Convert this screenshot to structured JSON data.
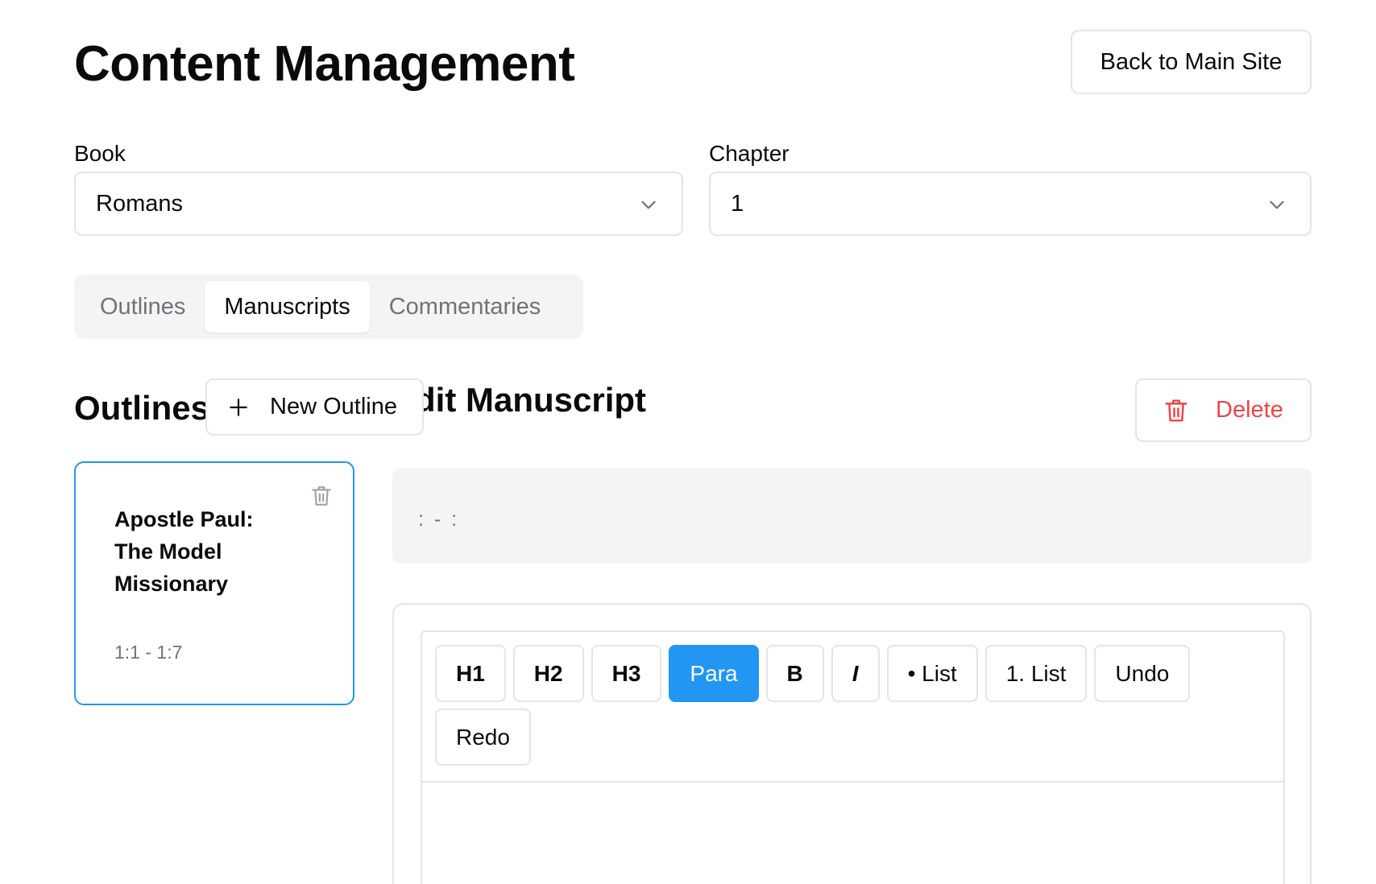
{
  "header": {
    "title": "Content Management",
    "back_label": "Back to Main Site"
  },
  "filters": {
    "book_label": "Book",
    "book_value": "Romans",
    "chapter_label": "Chapter",
    "chapter_value": "1"
  },
  "tabs": [
    {
      "label": "Outlines",
      "active": false
    },
    {
      "label": "Manuscripts",
      "active": true
    },
    {
      "label": "Commentaries",
      "active": false
    }
  ],
  "outlines": {
    "heading": "Outlines",
    "new_label": "New Outline",
    "items": [
      {
        "title": "Apostle Paul: The Model Missionary",
        "range": "1:1 - 1:7"
      }
    ]
  },
  "manuscript": {
    "heading": "Edit Manuscript",
    "delete_label": "Delete",
    "reference": ": - :"
  },
  "editor": {
    "toolbar": [
      "H1",
      "H2",
      "H3",
      "Para",
      "B",
      "I",
      "• List",
      "1. List",
      "Undo",
      "Redo"
    ],
    "active_tool": "Para"
  },
  "colors": {
    "accent": "#2196f3",
    "danger": "#ef4444",
    "muted": "#71717a",
    "border": "#e5e5e5"
  }
}
